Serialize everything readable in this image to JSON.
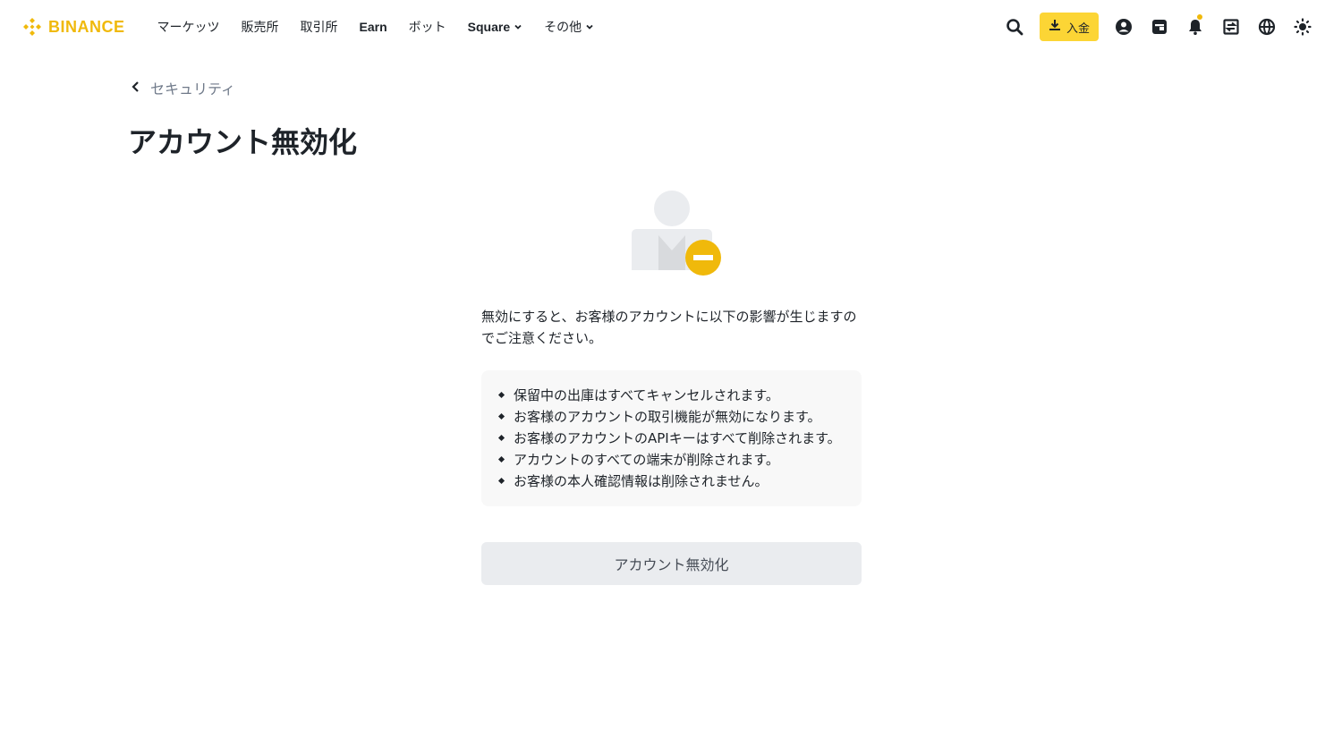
{
  "brand": {
    "name": "BINANCE",
    "color": "#f0b90b"
  },
  "nav": {
    "items": [
      {
        "label": "マーケッツ",
        "bold": false,
        "dropdown": false
      },
      {
        "label": "販売所",
        "bold": false,
        "dropdown": false
      },
      {
        "label": "取引所",
        "bold": false,
        "dropdown": false
      },
      {
        "label": "Earn",
        "bold": true,
        "dropdown": false
      },
      {
        "label": "ボット",
        "bold": false,
        "dropdown": false
      },
      {
        "label": "Square",
        "bold": true,
        "dropdown": true
      },
      {
        "label": "その他",
        "bold": false,
        "dropdown": true
      }
    ]
  },
  "toolbar": {
    "deposit_label": "入金",
    "icons": [
      "search-icon",
      "download-icon",
      "profile-icon",
      "wallet-icon",
      "bell-icon",
      "transfer-icon",
      "globe-icon",
      "theme-icon"
    ]
  },
  "breadcrumb": {
    "label": "セキュリティ"
  },
  "page": {
    "title": "アカウント無効化",
    "intro": "無効にすると、お客様のアカウントに以下の影響が生じますのでご注意ください。",
    "effects": [
      "保留中の出庫はすべてキャンセルされます。",
      "お客様のアカウントの取引機能が無効になります。",
      "お客様のアカウントのAPIキーはすべて削除されます。",
      "アカウントのすべての端末が削除されます。",
      "お客様の本人確認情報は削除されません。"
    ],
    "button_label": "アカウント無効化"
  },
  "colors": {
    "accent": "#fcd535",
    "text": "#1e2329",
    "muted": "#707a8a",
    "button_bg": "#eaecef"
  }
}
